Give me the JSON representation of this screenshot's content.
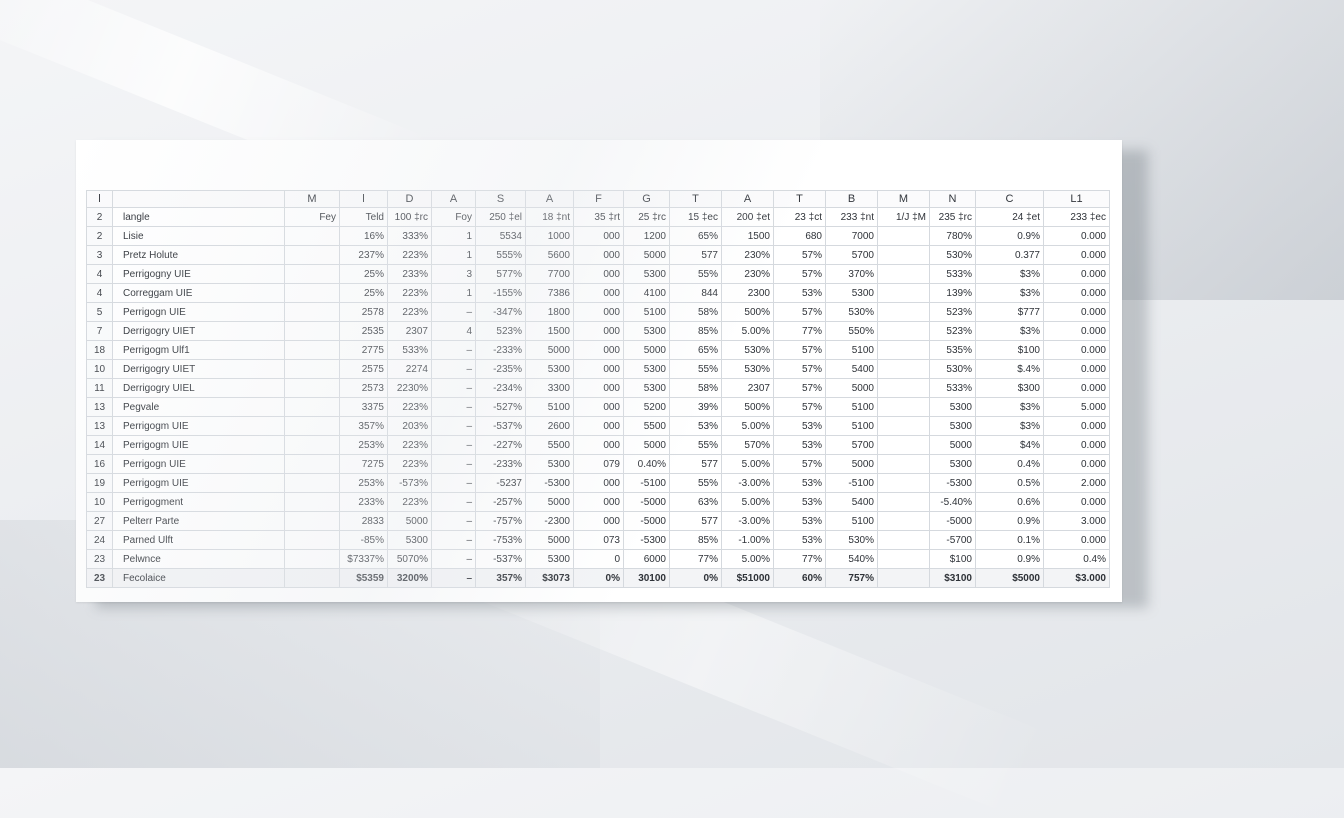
{
  "header_row": [
    "l",
    "",
    "M",
    "l",
    "D",
    "A",
    "S",
    "A",
    "F",
    "G",
    "T",
    "A",
    "T",
    "B",
    "M",
    "N",
    "C",
    "L1"
  ],
  "rows": [
    [
      "2",
      "langle",
      "Fey",
      "Teld",
      "100 ‡rc",
      "Foy",
      "250 ‡el",
      "18 ‡nt",
      "35 ‡rt",
      "25 ‡rc",
      "15 ‡ec",
      "200 ‡et",
      "23 ‡ct",
      "233 ‡nt",
      "1/J ‡M",
      "235 ‡rc",
      "24 ‡et",
      "233 ‡ec"
    ],
    [
      "2",
      "Lisie",
      "",
      "16%",
      "333%",
      "1",
      "5534",
      "1000",
      "000",
      "1200",
      "65%",
      "1500",
      "680",
      "7000",
      "",
      "780%",
      "0.9%",
      "0.000"
    ],
    [
      "3",
      "Pretz Holute",
      "",
      "237%",
      "223%",
      "1",
      "555%",
      "5600",
      "000",
      "5000",
      "577",
      "230%",
      "57%",
      "5700",
      "",
      "530%",
      "0.377",
      "0.000"
    ],
    [
      "4",
      "Perrigogny UIE",
      "",
      "25%",
      "233%",
      "3",
      "577%",
      "7700",
      "000",
      "5300",
      "55%",
      "230%",
      "57%",
      "370%",
      "",
      "533%",
      "$3%",
      "0.000"
    ],
    [
      "4",
      "Correggam UIE",
      "",
      "25%",
      "223%",
      "1",
      "-155%",
      "7386",
      "000",
      "4100",
      "844",
      "2300",
      "53%",
      "5300",
      "",
      "139%",
      "$3%",
      "0.000"
    ],
    [
      "5",
      "Perrigogn UIE",
      "",
      "2578",
      "223%",
      "–",
      "-347%",
      "1800",
      "000",
      "5100",
      "58%",
      "500%",
      "57%",
      "530%",
      "",
      "523%",
      "$777",
      "0.000"
    ],
    [
      "7",
      "Derrigogry UIET",
      "",
      "2535",
      "2307",
      "4",
      "523%",
      "1500",
      "000",
      "5300",
      "85%",
      "5.00%",
      "77%",
      "550%",
      "",
      "523%",
      "$3%",
      "0.000"
    ],
    [
      "18",
      "Perrigogm Ulf1",
      "",
      "2775",
      "533%",
      "–",
      "-233%",
      "5000",
      "000",
      "5000",
      "65%",
      "530%",
      "57%",
      "5100",
      "",
      "535%",
      "$100",
      "0.000"
    ],
    [
      "10",
      "Derrigogry UIET",
      "",
      "2575",
      "2274",
      "–",
      "-235%",
      "5300",
      "000",
      "5300",
      "55%",
      "530%",
      "57%",
      "5400",
      "",
      "530%",
      "$.4%",
      "0.000"
    ],
    [
      "11",
      "Derrigogry UIEL",
      "",
      "2573",
      "2230%",
      "–",
      "-234%",
      "3300",
      "000",
      "5300",
      "58%",
      "2307",
      "57%",
      "5000",
      "",
      "533%",
      "$300",
      "0.000"
    ],
    [
      "13",
      "Pegvale",
      "",
      "3375",
      "223%",
      "–",
      "-527%",
      "5100",
      "000",
      "5200",
      "39%",
      "500%",
      "57%",
      "5100",
      "",
      "5300",
      "$3%",
      "5.000"
    ],
    [
      "13",
      "Perrigogm UIE",
      "",
      "357%",
      "203%",
      "–",
      "-537%",
      "2600",
      "000",
      "5500",
      "53%",
      "5.00%",
      "53%",
      "5100",
      "",
      "5300",
      "$3%",
      "0.000"
    ],
    [
      "14",
      "Perrigogm UIE",
      "",
      "253%",
      "223%",
      "–",
      "-227%",
      "5500",
      "000",
      "5000",
      "55%",
      "570%",
      "53%",
      "5700",
      "",
      "5000",
      "$4%",
      "0.000"
    ],
    [
      "16",
      "Perrigogn UIE",
      "",
      "7275",
      "223%",
      "–",
      "-233%",
      "5300",
      "079",
      "0.40%",
      "577",
      "5.00%",
      "57%",
      "5000",
      "",
      "5300",
      "0.4%",
      "0.000"
    ],
    [
      "19",
      "Perrigogm UIE",
      "",
      "253%",
      "-573%",
      "–",
      "-5237",
      "-5300",
      "000",
      "-5100",
      "55%",
      "-3.00%",
      "53%",
      "-5100",
      "",
      "-5300",
      "0.5%",
      "2.000"
    ],
    [
      "10",
      "Perrigogment",
      "",
      "233%",
      "223%",
      "–",
      "-257%",
      "5000",
      "000",
      "-5000",
      "63%",
      "5.00%",
      "53%",
      "5400",
      "",
      "-5.40%",
      "0.6%",
      "0.000"
    ],
    [
      "27",
      "Pelterr Parte",
      "",
      "2833",
      "5000",
      "–",
      "-757%",
      "-2300",
      "000",
      "-5000",
      "577",
      "-3.00%",
      "53%",
      "5100",
      "",
      "-5000",
      "0.9%",
      "3.000"
    ],
    [
      "24",
      "Parned Ulft",
      "",
      "-85%",
      "5300",
      "–",
      "-753%",
      "5000",
      "073",
      "-5300",
      "85%",
      "-1.00%",
      "53%",
      "530%",
      "",
      "-5700",
      "0.1%",
      "0.000"
    ],
    [
      "23",
      "Pelwnce",
      "",
      "$7337%",
      "5070%",
      "–",
      "-537%",
      "5300",
      "0",
      "6000",
      "77%",
      "5.00%",
      "77%",
      "540%",
      "",
      "$100",
      "0.9%",
      "0.4%"
    ],
    [
      "23",
      "Fecolaice",
      "",
      "$5359",
      "3200%",
      "–",
      "357%",
      "$3073",
      "0%",
      "30100",
      "0%",
      "$51000",
      "60%",
      "757%",
      "",
      "$3100",
      "$5000",
      "$3.000"
    ]
  ]
}
